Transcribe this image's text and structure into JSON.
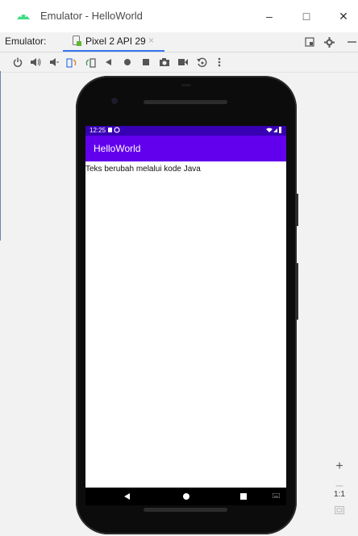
{
  "window": {
    "title": "Emulator - HelloWorld",
    "minimize_glyph": "–",
    "maximize_glyph": "□",
    "close_glyph": "✕"
  },
  "tabs": {
    "label": "Emulator:",
    "active_tab": "Pixel 2 API 29",
    "close_glyph": "×"
  },
  "device": {
    "status_time": "12:25",
    "app_title": "HelloWorld",
    "content_text": "Teks berubah melalui kode Java"
  },
  "zoom": {
    "zoom_in": "+",
    "zoom_out": "–",
    "actual_size": "1:1"
  },
  "colors": {
    "status_bar": "#3700b3",
    "app_bar": "#6200ee",
    "tab_underline": "#3574f0"
  }
}
